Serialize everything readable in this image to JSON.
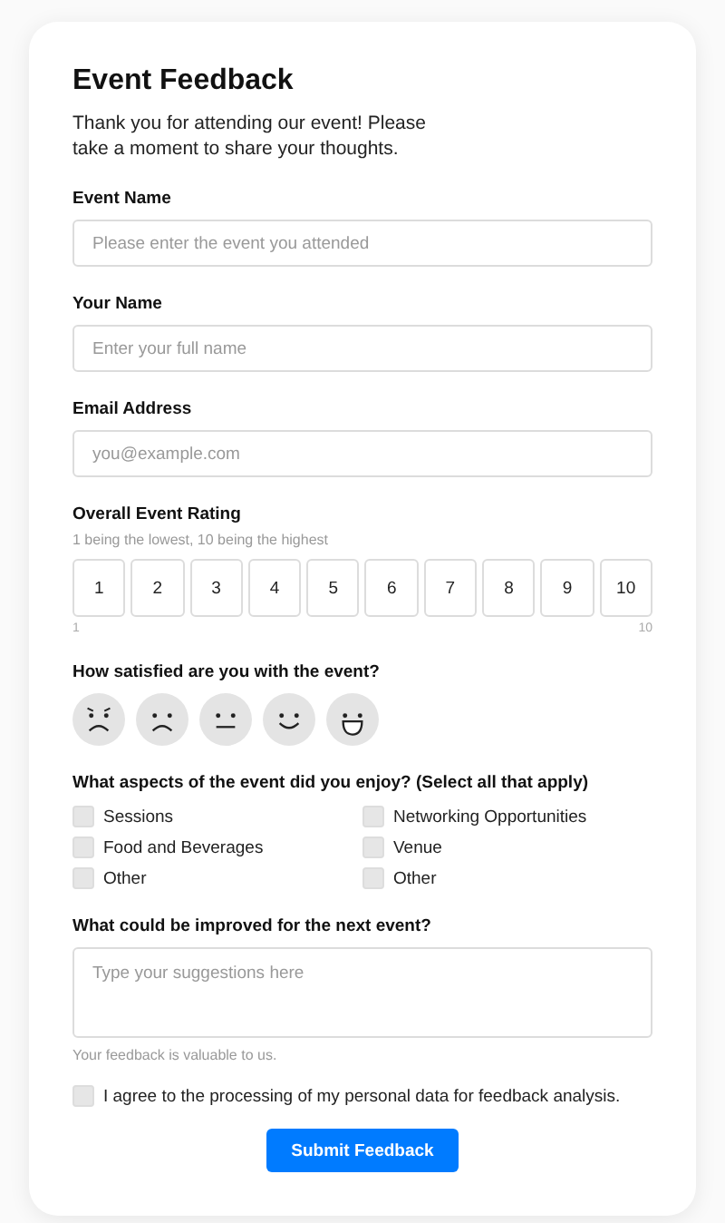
{
  "title": "Event Feedback",
  "intro": "Thank you for attending our event! Please take a moment to share your thoughts.",
  "fields": [
    {
      "label": "Event Name",
      "placeholder": "Please enter the event you attended"
    },
    {
      "label": "Your Name",
      "placeholder": "Enter your full name"
    },
    {
      "label": "Email Address",
      "placeholder": "you@example.com"
    }
  ],
  "rating": {
    "label": "Overall Event Rating",
    "hint": "1 being the lowest, 10 being the highest",
    "options": [
      {
        "label": "1",
        "selected": false
      },
      {
        "label": "2",
        "selected": false
      },
      {
        "label": "3",
        "selected": false
      },
      {
        "label": "4",
        "selected": false
      },
      {
        "label": "5",
        "selected": false
      },
      {
        "label": "6",
        "selected": false
      },
      {
        "label": "7",
        "selected": false
      },
      {
        "label": "8",
        "selected": false
      },
      {
        "label": "9",
        "selected": false
      },
      {
        "label": "10",
        "selected": false
      }
    ],
    "min_label": "1",
    "max_label": "10"
  },
  "satisfaction": {
    "label": "How satisfied are you with the event?",
    "faces": [
      {
        "kind": "angry",
        "selected": false
      },
      {
        "kind": "sad",
        "selected": false
      },
      {
        "kind": "neutral",
        "selected": false
      },
      {
        "kind": "happy",
        "selected": false
      },
      {
        "kind": "delighted",
        "selected": false
      }
    ]
  },
  "aspects": {
    "label": "What aspects of the event did you enjoy? (Select all that apply)",
    "options": [
      {
        "label": "Sessions",
        "checked": false
      },
      {
        "label": "Networking Opportunities",
        "checked": false
      },
      {
        "label": "Food and Beverages",
        "checked": false
      },
      {
        "label": "Venue",
        "checked": false
      },
      {
        "label": "Other",
        "checked": false
      },
      {
        "label": "Other",
        "checked": false
      }
    ]
  },
  "improve": {
    "label": "What could be improved for the next event?",
    "placeholder": "Type your suggestions here",
    "hint": "Your feedback is valuable to us."
  },
  "consent": {
    "label": "I agree to the processing of my personal data for feedback analysis.",
    "checked": false
  },
  "submit": "Submit Feedback"
}
